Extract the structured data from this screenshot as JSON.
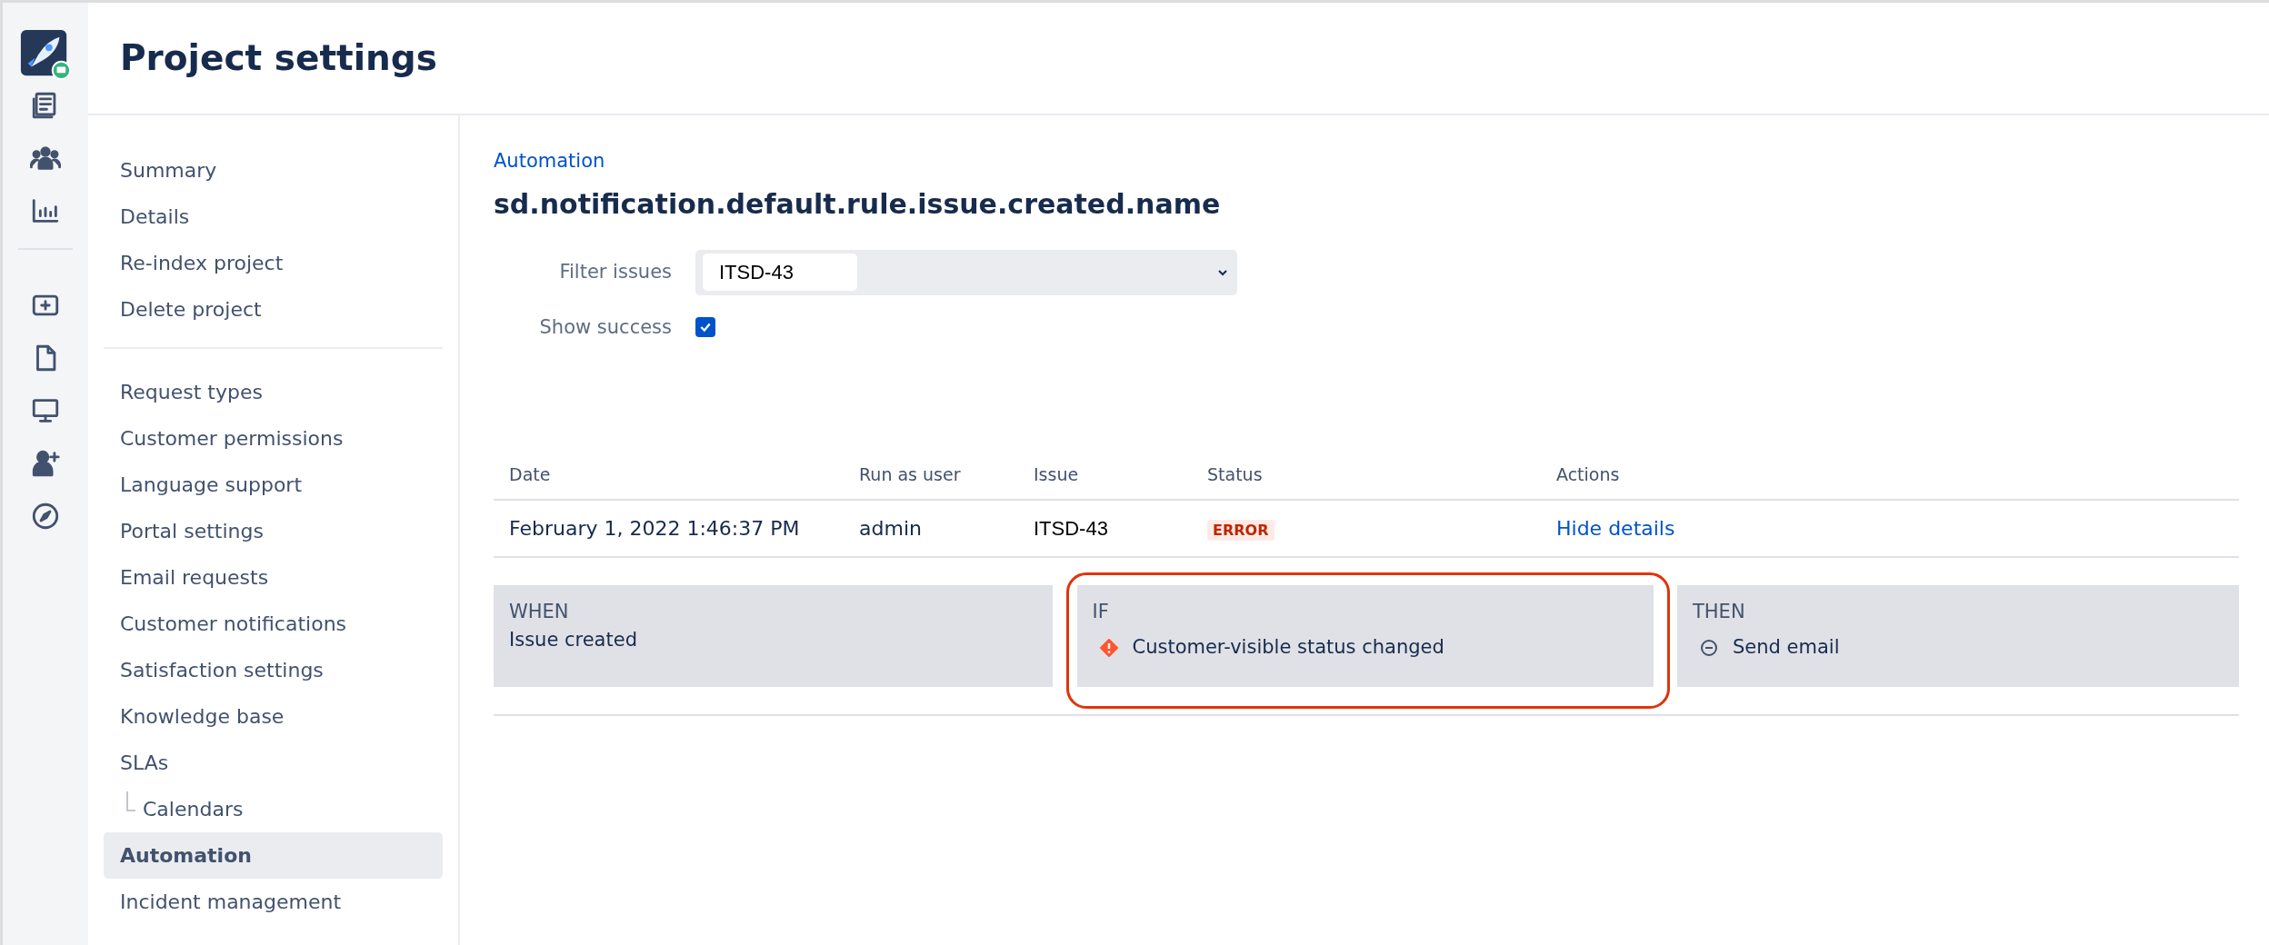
{
  "header": {
    "title": "Project settings"
  },
  "sidebar": {
    "groups": [
      {
        "items": [
          {
            "label": "Summary",
            "selected": false
          },
          {
            "label": "Details",
            "selected": false
          },
          {
            "label": "Re-index project",
            "selected": false
          },
          {
            "label": "Delete project",
            "selected": false
          }
        ]
      },
      {
        "items": [
          {
            "label": "Request types",
            "selected": false
          },
          {
            "label": "Customer permissions",
            "selected": false
          },
          {
            "label": "Language support",
            "selected": false
          },
          {
            "label": "Portal settings",
            "selected": false
          },
          {
            "label": "Email requests",
            "selected": false
          },
          {
            "label": "Customer notifications",
            "selected": false
          },
          {
            "label": "Satisfaction settings",
            "selected": false
          },
          {
            "label": "Knowledge base",
            "selected": false
          },
          {
            "label": "SLAs",
            "selected": false,
            "children": [
              {
                "label": "Calendars",
                "selected": false
              }
            ]
          },
          {
            "label": "Automation",
            "selected": true
          },
          {
            "label": "Incident management",
            "selected": false
          }
        ]
      }
    ]
  },
  "breadcrumb": "Automation",
  "heading": "sd.notification.default.rule.issue.created.name",
  "filter": {
    "label": "Filter issues",
    "value": "ITSD-43"
  },
  "show_success": {
    "label": "Show success",
    "checked": true
  },
  "table": {
    "columns": [
      "Date",
      "Run as user",
      "Issue",
      "Status",
      "Actions"
    ],
    "rows": [
      {
        "date": "February 1, 2022 1:46:37 PM",
        "run_as_user": "admin",
        "issue": "ITSD-43",
        "status": "ERROR",
        "action": "Hide details"
      }
    ]
  },
  "rule": [
    {
      "label": "WHEN",
      "highlighted": false,
      "items": [
        {
          "text": "Issue created"
        }
      ]
    },
    {
      "label": "IF",
      "highlighted": true,
      "items": [
        {
          "text": "Customer-visible status changed",
          "kind": "error"
        }
      ]
    },
    {
      "label": "THEN",
      "highlighted": false,
      "items": [
        {
          "text": "Send email",
          "kind": "skipped"
        }
      ]
    }
  ]
}
